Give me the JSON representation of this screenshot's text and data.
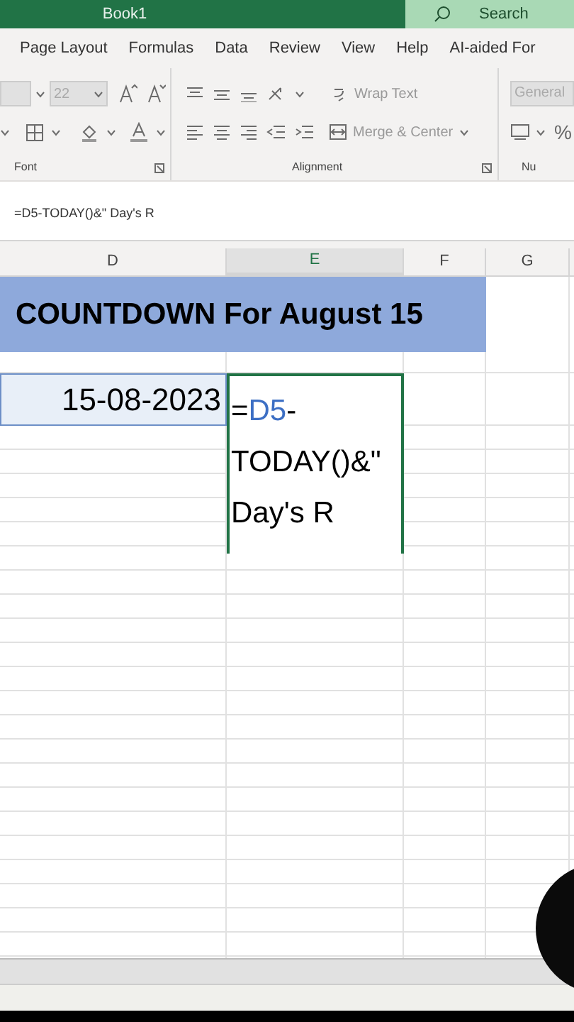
{
  "title_bar": {
    "title": "Book1",
    "search": {
      "placeholder": "Search"
    }
  },
  "ribbon_tabs": [
    {
      "label": "Page Layout",
      "selected": false
    },
    {
      "label": "Formulas",
      "selected": false
    },
    {
      "label": "Data",
      "selected": false
    },
    {
      "label": "Review",
      "selected": false
    },
    {
      "label": "View",
      "selected": false
    },
    {
      "label": "Help",
      "selected": false
    },
    {
      "label": "AI-aided For",
      "selected": false
    }
  ],
  "ribbon": {
    "font_size": "22",
    "wrap_text": "Wrap Text",
    "merge": "Merge & Center",
    "number_format": "General",
    "percent": "%",
    "groups": [
      "Font",
      "Alignment",
      "Nu"
    ]
  },
  "formula_bar": {
    "value": "=D5-TODAY()&\" Day's R"
  },
  "columns": [
    {
      "label": "D",
      "selected": false
    },
    {
      "label": "E",
      "selected": true
    },
    {
      "label": "F",
      "selected": false
    },
    {
      "label": "G",
      "selected": false
    }
  ],
  "title_cell": "COUNTDOWN For August 15",
  "date_cell": "15-08-2023",
  "editing_cell": [
    {
      "kind": "plain",
      "text": "="
    },
    {
      "kind": "ref",
      "text": "D5"
    },
    {
      "kind": "plain",
      "text": "-TODAY()&\" Day's R"
    }
  ]
}
